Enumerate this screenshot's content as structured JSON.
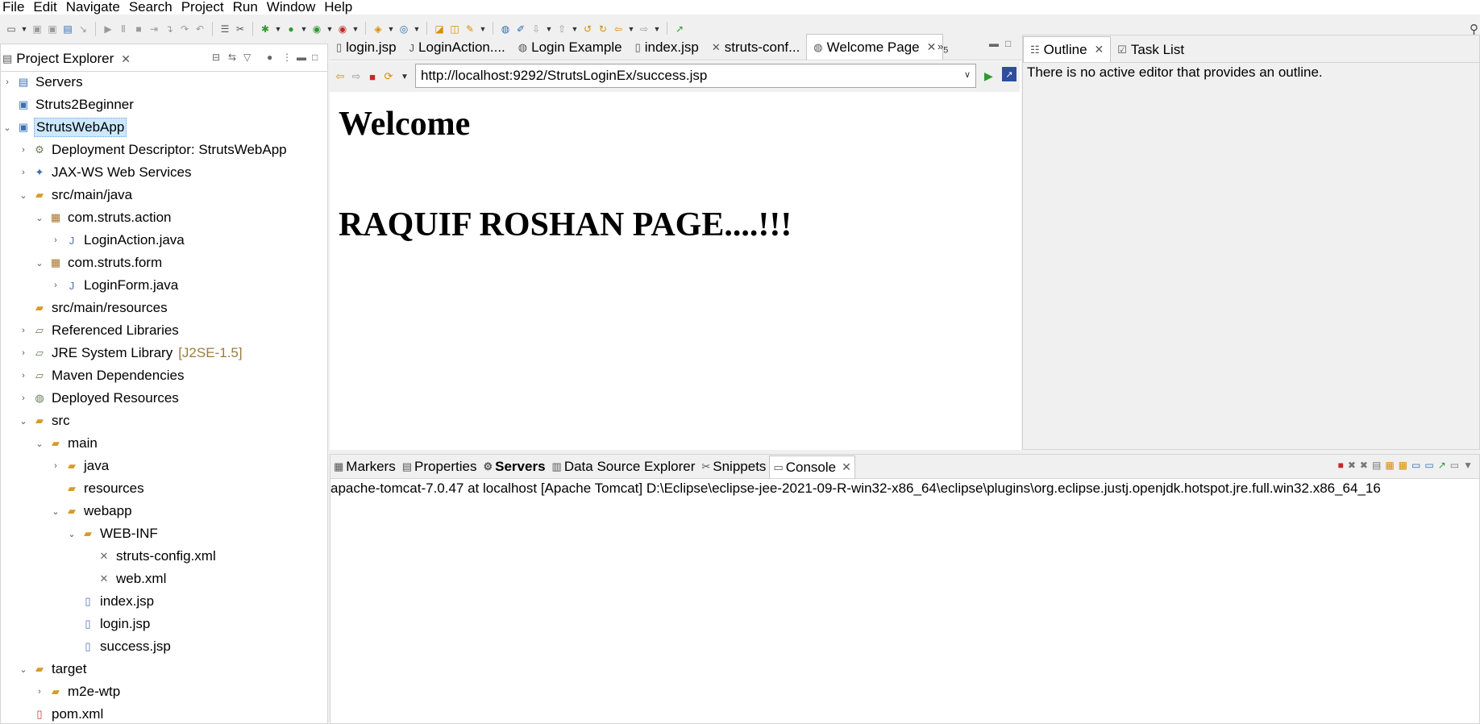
{
  "menu": [
    "File",
    "Edit",
    "Navigate",
    "Search",
    "Project",
    "Run",
    "Window",
    "Help"
  ],
  "project_explorer": {
    "tab_label": "Project Explorer",
    "tree": [
      {
        "label": "Servers",
        "depth": 0,
        "arrow": "right",
        "icon": "server-folder-icon"
      },
      {
        "label": "Struts2Beginner",
        "depth": 0,
        "arrow": "none",
        "icon": "project-icon"
      },
      {
        "label": "StrutsWebApp",
        "depth": 0,
        "arrow": "down",
        "icon": "web-project-icon",
        "selected": true
      },
      {
        "label": "Deployment Descriptor: StrutsWebApp",
        "depth": 1,
        "arrow": "right",
        "icon": "deployment-descriptor-icon"
      },
      {
        "label": "JAX-WS Web Services",
        "depth": 1,
        "arrow": "right",
        "icon": "web-services-icon"
      },
      {
        "label": "src/main/java",
        "depth": 1,
        "arrow": "down",
        "icon": "source-folder-icon"
      },
      {
        "label": "com.struts.action",
        "depth": 2,
        "arrow": "down",
        "icon": "package-icon"
      },
      {
        "label": "LoginAction.java",
        "depth": 3,
        "arrow": "right",
        "icon": "java-file-icon"
      },
      {
        "label": "com.struts.form",
        "depth": 2,
        "arrow": "down",
        "icon": "package-icon"
      },
      {
        "label": "LoginForm.java",
        "depth": 3,
        "arrow": "right",
        "icon": "java-file-icon"
      },
      {
        "label": "src/main/resources",
        "depth": 1,
        "arrow": "none",
        "icon": "source-folder-icon"
      },
      {
        "label": "Referenced Libraries",
        "depth": 1,
        "arrow": "right",
        "icon": "library-icon"
      },
      {
        "label": "JRE System Library",
        "depth": 1,
        "arrow": "right",
        "icon": "library-icon",
        "decoration": "[J2SE-1.5]"
      },
      {
        "label": "Maven Dependencies",
        "depth": 1,
        "arrow": "right",
        "icon": "library-icon"
      },
      {
        "label": "Deployed Resources",
        "depth": 1,
        "arrow": "right",
        "icon": "deployed-resources-icon"
      },
      {
        "label": "src",
        "depth": 1,
        "arrow": "down",
        "icon": "folder-icon"
      },
      {
        "label": "main",
        "depth": 2,
        "arrow": "down",
        "icon": "folder-icon"
      },
      {
        "label": "java",
        "depth": 3,
        "arrow": "right",
        "icon": "folder-icon"
      },
      {
        "label": "resources",
        "depth": 3,
        "arrow": "none",
        "icon": "folder-icon"
      },
      {
        "label": "webapp",
        "depth": 3,
        "arrow": "down",
        "icon": "folder-icon"
      },
      {
        "label": "WEB-INF",
        "depth": 4,
        "arrow": "down",
        "icon": "folder-icon"
      },
      {
        "label": "struts-config.xml",
        "depth": 5,
        "arrow": "none",
        "icon": "xml-file-icon"
      },
      {
        "label": "web.xml",
        "depth": 5,
        "arrow": "none",
        "icon": "xml-file-icon"
      },
      {
        "label": "index.jsp",
        "depth": 4,
        "arrow": "none",
        "icon": "jsp-file-icon"
      },
      {
        "label": "login.jsp",
        "depth": 4,
        "arrow": "none",
        "icon": "jsp-file-icon"
      },
      {
        "label": "success.jsp",
        "depth": 4,
        "arrow": "none",
        "icon": "jsp-file-icon"
      },
      {
        "label": "target",
        "depth": 1,
        "arrow": "down",
        "icon": "folder-icon"
      },
      {
        "label": "m2e-wtp",
        "depth": 2,
        "arrow": "right",
        "icon": "folder-icon"
      },
      {
        "label": "pom.xml",
        "depth": 1,
        "arrow": "none",
        "icon": "pom-file-icon"
      }
    ]
  },
  "editor": {
    "tabs": [
      {
        "label": "login.jsp",
        "icon": "jsp-file-icon"
      },
      {
        "label": "LoginAction....",
        "icon": "java-file-icon"
      },
      {
        "label": "Login Example",
        "icon": "globe-icon"
      },
      {
        "label": "index.jsp",
        "icon": "jsp-file-icon"
      },
      {
        "label": "struts-conf...",
        "icon": "xml-file-icon"
      },
      {
        "label": "Welcome Page",
        "icon": "globe-icon",
        "active": true
      }
    ],
    "overflow_label": "5",
    "url": "http://localhost:9292/StrutsLoginEx/success.jsp",
    "page": {
      "heading1": "Welcome",
      "heading2": "RAQUIF ROSHAN PAGE....!!!"
    }
  },
  "outline": {
    "tabs": [
      {
        "label": "Outline",
        "icon": "outline-icon",
        "active": true
      },
      {
        "label": "Task List",
        "icon": "task-list-icon"
      }
    ],
    "message": "There is no active editor that provides an outline."
  },
  "bottom_panel": {
    "tabs": [
      {
        "label": "Markers",
        "icon": "markers-icon"
      },
      {
        "label": "Properties",
        "icon": "properties-icon"
      },
      {
        "label": "Servers",
        "icon": "servers-icon",
        "bold": true
      },
      {
        "label": "Data Source Explorer",
        "icon": "data-source-icon"
      },
      {
        "label": "Snippets",
        "icon": "snippets-icon"
      },
      {
        "label": "Console",
        "icon": "console-icon",
        "active": true
      }
    ],
    "console_line": "apache-tomcat-7.0.47 at localhost [Apache Tomcat] D:\\Eclipse\\eclipse-jee-2021-09-R-win32-x86_64\\eclipse\\plugins\\org.eclipse.justj.openjdk.hotspot.jre.full.win32.x86_64_16"
  },
  "colors": {
    "selection": "#cce8ff",
    "decoration": "#9a7b3f",
    "folder": "#d79b2b",
    "run_green": "#2d9a2d",
    "stop_red": "#c62828"
  }
}
